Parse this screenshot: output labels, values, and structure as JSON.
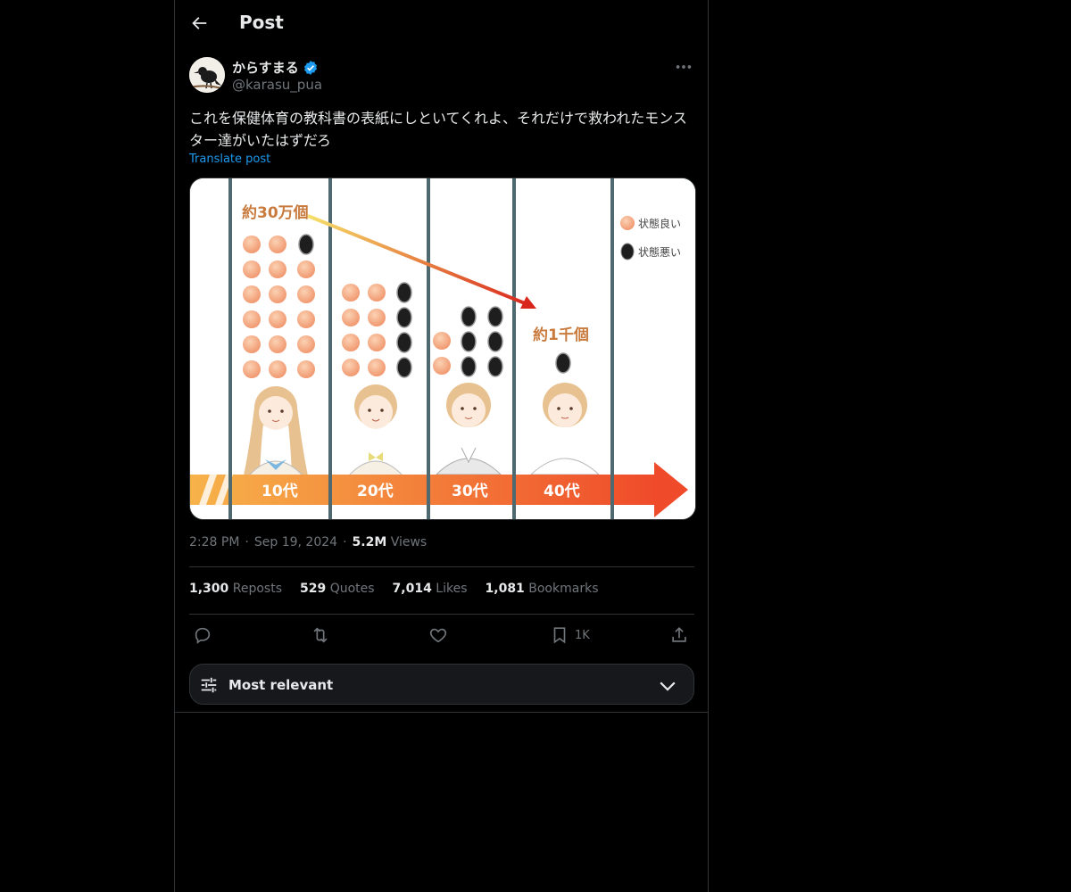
{
  "header": {
    "title": "Post",
    "back_icon": "arrow-left-icon"
  },
  "author": {
    "name": "からすまる",
    "handle": "@karasu_pua",
    "verified": true,
    "badge_color": "#1d9bf0"
  },
  "post": {
    "text": "これを保健体育の教科書の表紙にしといてくれよ、それだけで救われたモンスター達がいたはずだろ",
    "translate_label": "Translate post",
    "time": "2:28 PM",
    "date": "Sep 19, 2024",
    "views_count": "5.2M",
    "views_label": "Views"
  },
  "image": {
    "top_label": "約30万個",
    "bottom_label": "約1千個",
    "legend_good": "状態良い",
    "legend_bad": "状態悪い",
    "ages": [
      "10代",
      "20代",
      "30代",
      "40代"
    ],
    "good_color": "#f4a57a",
    "bad_color": "#1e1e1e",
    "arrow_color": "#ef5a2a"
  },
  "stats": {
    "reposts_count": "1,300",
    "reposts_label": "Reposts",
    "quotes_count": "529",
    "quotes_label": "Quotes",
    "likes_count": "7,014",
    "likes_label": "Likes",
    "bookmarks_count": "1,081",
    "bookmarks_label": "Bookmarks"
  },
  "actions": {
    "bookmark_count": "1K"
  },
  "sort": {
    "label": "Most relevant"
  }
}
